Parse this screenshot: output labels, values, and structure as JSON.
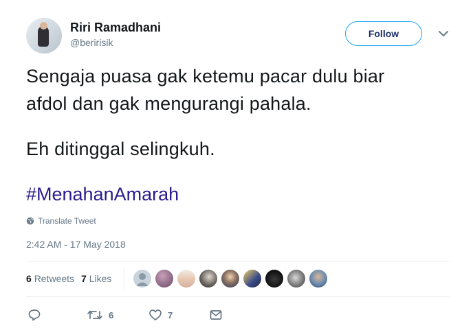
{
  "author": {
    "display_name": "Riri Ramadhani",
    "username": "@beririsik",
    "avatar_icon": "profile-photo"
  },
  "follow_button": {
    "label": "Follow",
    "color": "#1da1f2"
  },
  "more_menu": {
    "icon": "chevron-down-icon"
  },
  "tweet": {
    "lines": [
      "Sengaja puasa gak ketemu pacar dulu biar",
      "afdol dan gak mengurangi pahala.",
      "Eh ditinggal selingkuh."
    ],
    "hashtag": "#MenahanAmarah",
    "hashtag_color": "#2b1b8c"
  },
  "translate": {
    "label": "Translate Tweet",
    "icon": "globe-icon"
  },
  "timestamp": "2:42 AM - 17 May 2018",
  "stats": {
    "retweets_count": "6",
    "retweets_label": "Retweets",
    "likes_count": "7",
    "likes_label": "Likes"
  },
  "liker_avatars": [
    {
      "name": "default-avatar"
    },
    {
      "name": "avatar-2"
    },
    {
      "name": "avatar-3"
    },
    {
      "name": "avatar-4"
    },
    {
      "name": "avatar-5"
    },
    {
      "name": "avatar-6"
    },
    {
      "name": "avatar-7"
    },
    {
      "name": "avatar-8"
    },
    {
      "name": "avatar-9"
    }
  ],
  "actions": {
    "reply_icon": "reply-icon",
    "retweet_icon": "retweet-icon",
    "retweet_count": "6",
    "like_icon": "heart-icon",
    "like_count": "7",
    "dm_icon": "envelope-icon"
  },
  "colors": {
    "text": "#14171a",
    "secondary": "#657786",
    "border": "#e6ecf0"
  }
}
